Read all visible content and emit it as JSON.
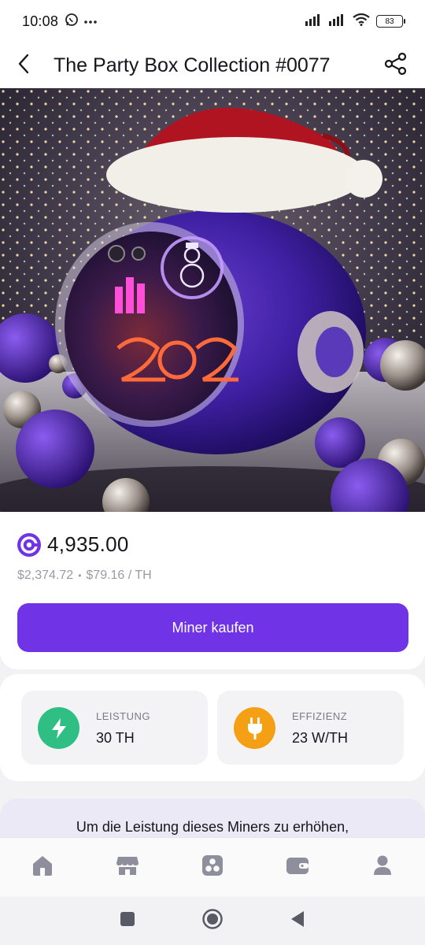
{
  "status_bar": {
    "time": "10:08",
    "battery": "83",
    "icons": [
      "whatsapp-icon",
      "more-dots-icon",
      "signal-icon",
      "signal-icon",
      "wifi-icon",
      "battery-icon"
    ]
  },
  "header": {
    "title": "The Party Box Collection #0077",
    "back_icon": "chevron-left-icon",
    "share_icon": "share-icon"
  },
  "hero": {
    "image": "nft-artwork"
  },
  "price": {
    "amount": "4,935.00",
    "usd": "$2,374.72",
    "separator": "•",
    "per_th": "$79.16 / TH",
    "coin_icon": "gomining-coin-icon"
  },
  "buy_button": {
    "label": "Miner kaufen",
    "color": "#7034e6"
  },
  "stats": [
    {
      "label": "LEISTUNG",
      "value": "30 TH",
      "icon": "lightning-icon",
      "color": "#2fbf85"
    },
    {
      "label": "EFFIZIENZ",
      "value": "23 W/TH",
      "icon": "plug-icon",
      "color": "#f5a014"
    }
  ],
  "info": {
    "text": "Um die Leistung dieses Miners zu erhöhen,"
  },
  "bottom_nav": [
    {
      "name": "home",
      "icon": "home-icon"
    },
    {
      "name": "marketplace",
      "icon": "store-icon"
    },
    {
      "name": "mining",
      "icon": "fan-icon"
    },
    {
      "name": "wallet",
      "icon": "wallet-icon"
    },
    {
      "name": "profile",
      "icon": "user-icon"
    }
  ],
  "system_nav": [
    "recents-icon",
    "home-circle-icon",
    "back-triangle-icon"
  ]
}
